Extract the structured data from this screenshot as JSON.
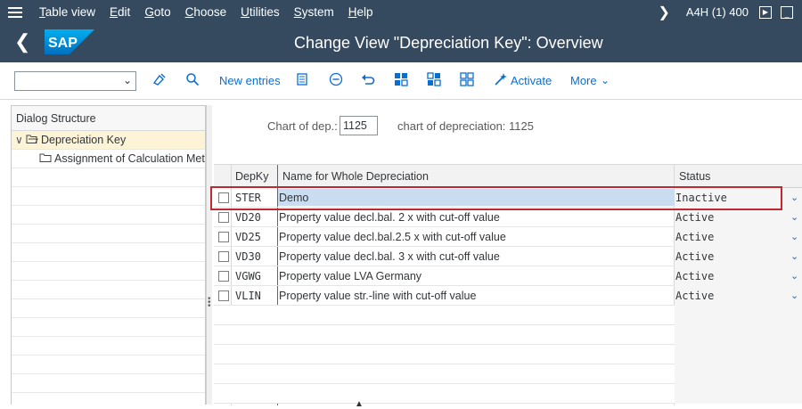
{
  "menubar": {
    "items": [
      {
        "label": "Table view",
        "underline": "T",
        "rest": "able view"
      },
      {
        "label": "Edit",
        "underline": "E",
        "rest": "dit"
      },
      {
        "label": "Goto",
        "underline": "G",
        "rest": "oto"
      },
      {
        "label": "Choose",
        "underline": "C",
        "rest": "hoose"
      },
      {
        "label": "Utilities",
        "underline": "U",
        "rest": "tilities"
      },
      {
        "label": "System",
        "underline": "S",
        "rest": "ystem"
      },
      {
        "label": "Help",
        "underline": "H",
        "rest": "elp"
      }
    ],
    "system_info": "A4H (1) 400"
  },
  "titlebar": {
    "title": "Change View \"Depreciation Key\": Overview",
    "logo_text": "SAP"
  },
  "toolbar": {
    "command_field_value": "",
    "new_entries_label": "New entries",
    "activate_label": "Activate",
    "more_label": "More",
    "accent_color": "#0a6ed1"
  },
  "dialog_structure": {
    "header": "Dialog Structure",
    "items": [
      {
        "label": "Depreciation Key",
        "selected": true,
        "level": 0
      },
      {
        "label": "Assignment of Calculation Methods",
        "selected": false,
        "level": 1
      }
    ]
  },
  "filter": {
    "label": "Chart of dep.:",
    "value": "1125",
    "description": "chart of depreciation: 1125"
  },
  "table": {
    "columns": [
      "DepKy",
      "Name for Whole Depreciation",
      "Status"
    ],
    "rows": [
      {
        "key": "STER",
        "name": "Demo",
        "status": "Inactive"
      },
      {
        "key": "VD20",
        "name": "Property value decl.bal.  2 x with cut-off value",
        "status": "Active"
      },
      {
        "key": "VD25",
        "name": "Property value decl.bal.2.5 x with cut-off value",
        "status": "Active"
      },
      {
        "key": "VD30",
        "name": "Property value decl.bal.  3 x with cut-off value",
        "status": "Active"
      },
      {
        "key": "VGWG",
        "name": "Property value LVA Germany",
        "status": "Active"
      },
      {
        "key": "VLIN",
        "name": "Property value str.-line with cut-off value",
        "status": "Active"
      }
    ]
  },
  "colors": {
    "shell": "#354a5f",
    "highlight_border": "#c0292f",
    "selection": "#c9dcf0"
  }
}
